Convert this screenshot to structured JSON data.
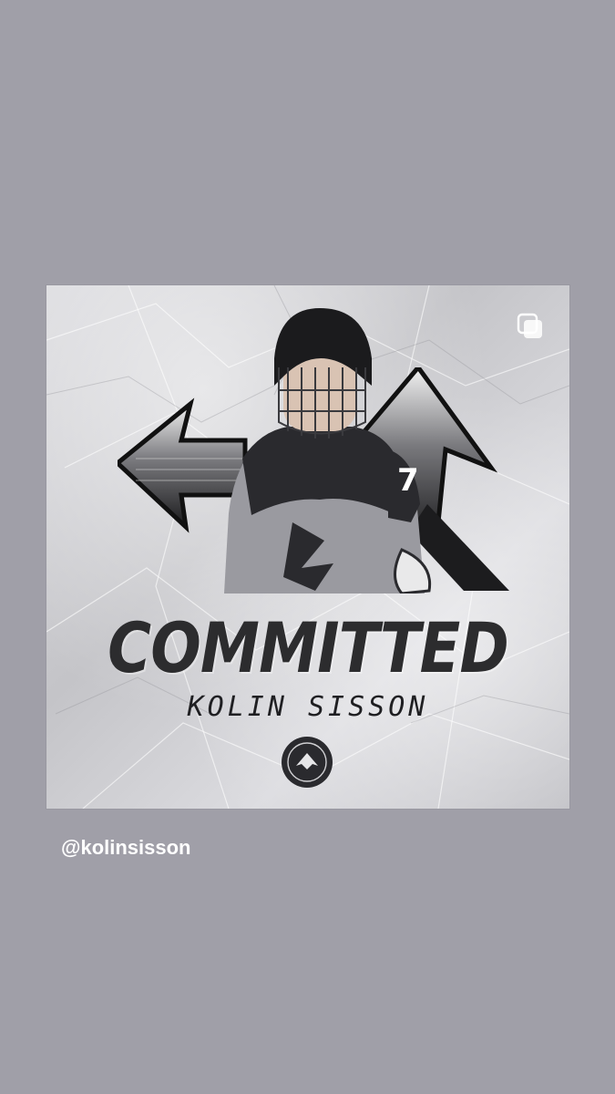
{
  "post": {
    "headline": "COMMITTED",
    "player_name": "KOLIN SISSON",
    "jersey_number": "7",
    "multiple_images_icon": "multiple-images-icon"
  },
  "mention": {
    "handle": "@kolinsisson"
  }
}
